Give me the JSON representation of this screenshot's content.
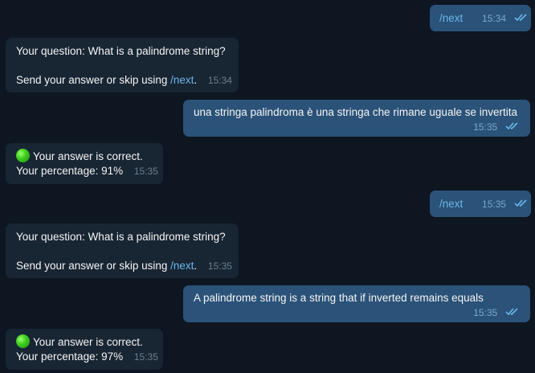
{
  "messages": [
    {
      "dir": "out",
      "text": "/next",
      "link": true,
      "time": "15:34"
    },
    {
      "dir": "in",
      "line1": "Your question: What is a palindrome string?",
      "line2_prefix": "Send your answer or skip using ",
      "line2_link": "/next",
      "line2_suffix": ".",
      "time": "15:34"
    },
    {
      "dir": "out",
      "text": "una stringa palindroma è una stringa che rimane uguale se invertita",
      "time": "15:35"
    },
    {
      "dir": "in",
      "line1": "Your answer is correct.",
      "line2": "Your percentage: 91%",
      "time": "15:35",
      "emoji": "green-circle-icon"
    },
    {
      "dir": "out",
      "text": "/next",
      "link": true,
      "time": "15:35"
    },
    {
      "dir": "in",
      "line1": "Your question: What is a palindrome string?",
      "line2_prefix": "Send your answer or skip using ",
      "line2_link": "/next",
      "line2_suffix": ".",
      "time": "15:35"
    },
    {
      "dir": "out",
      "text": "A palindrome string is a string that if inverted remains equals",
      "time": "15:35"
    },
    {
      "dir": "in",
      "line1": "Your answer is correct.",
      "line2": "Your percentage: 97%",
      "time": "15:35",
      "emoji": "green-circle-icon"
    }
  ],
  "colors": {
    "background": "#0e1621",
    "incoming_bubble": "#182533",
    "outgoing_bubble": "#2b5278",
    "link": "#6ab7ec",
    "read_ticks": "#6ab7ec"
  }
}
